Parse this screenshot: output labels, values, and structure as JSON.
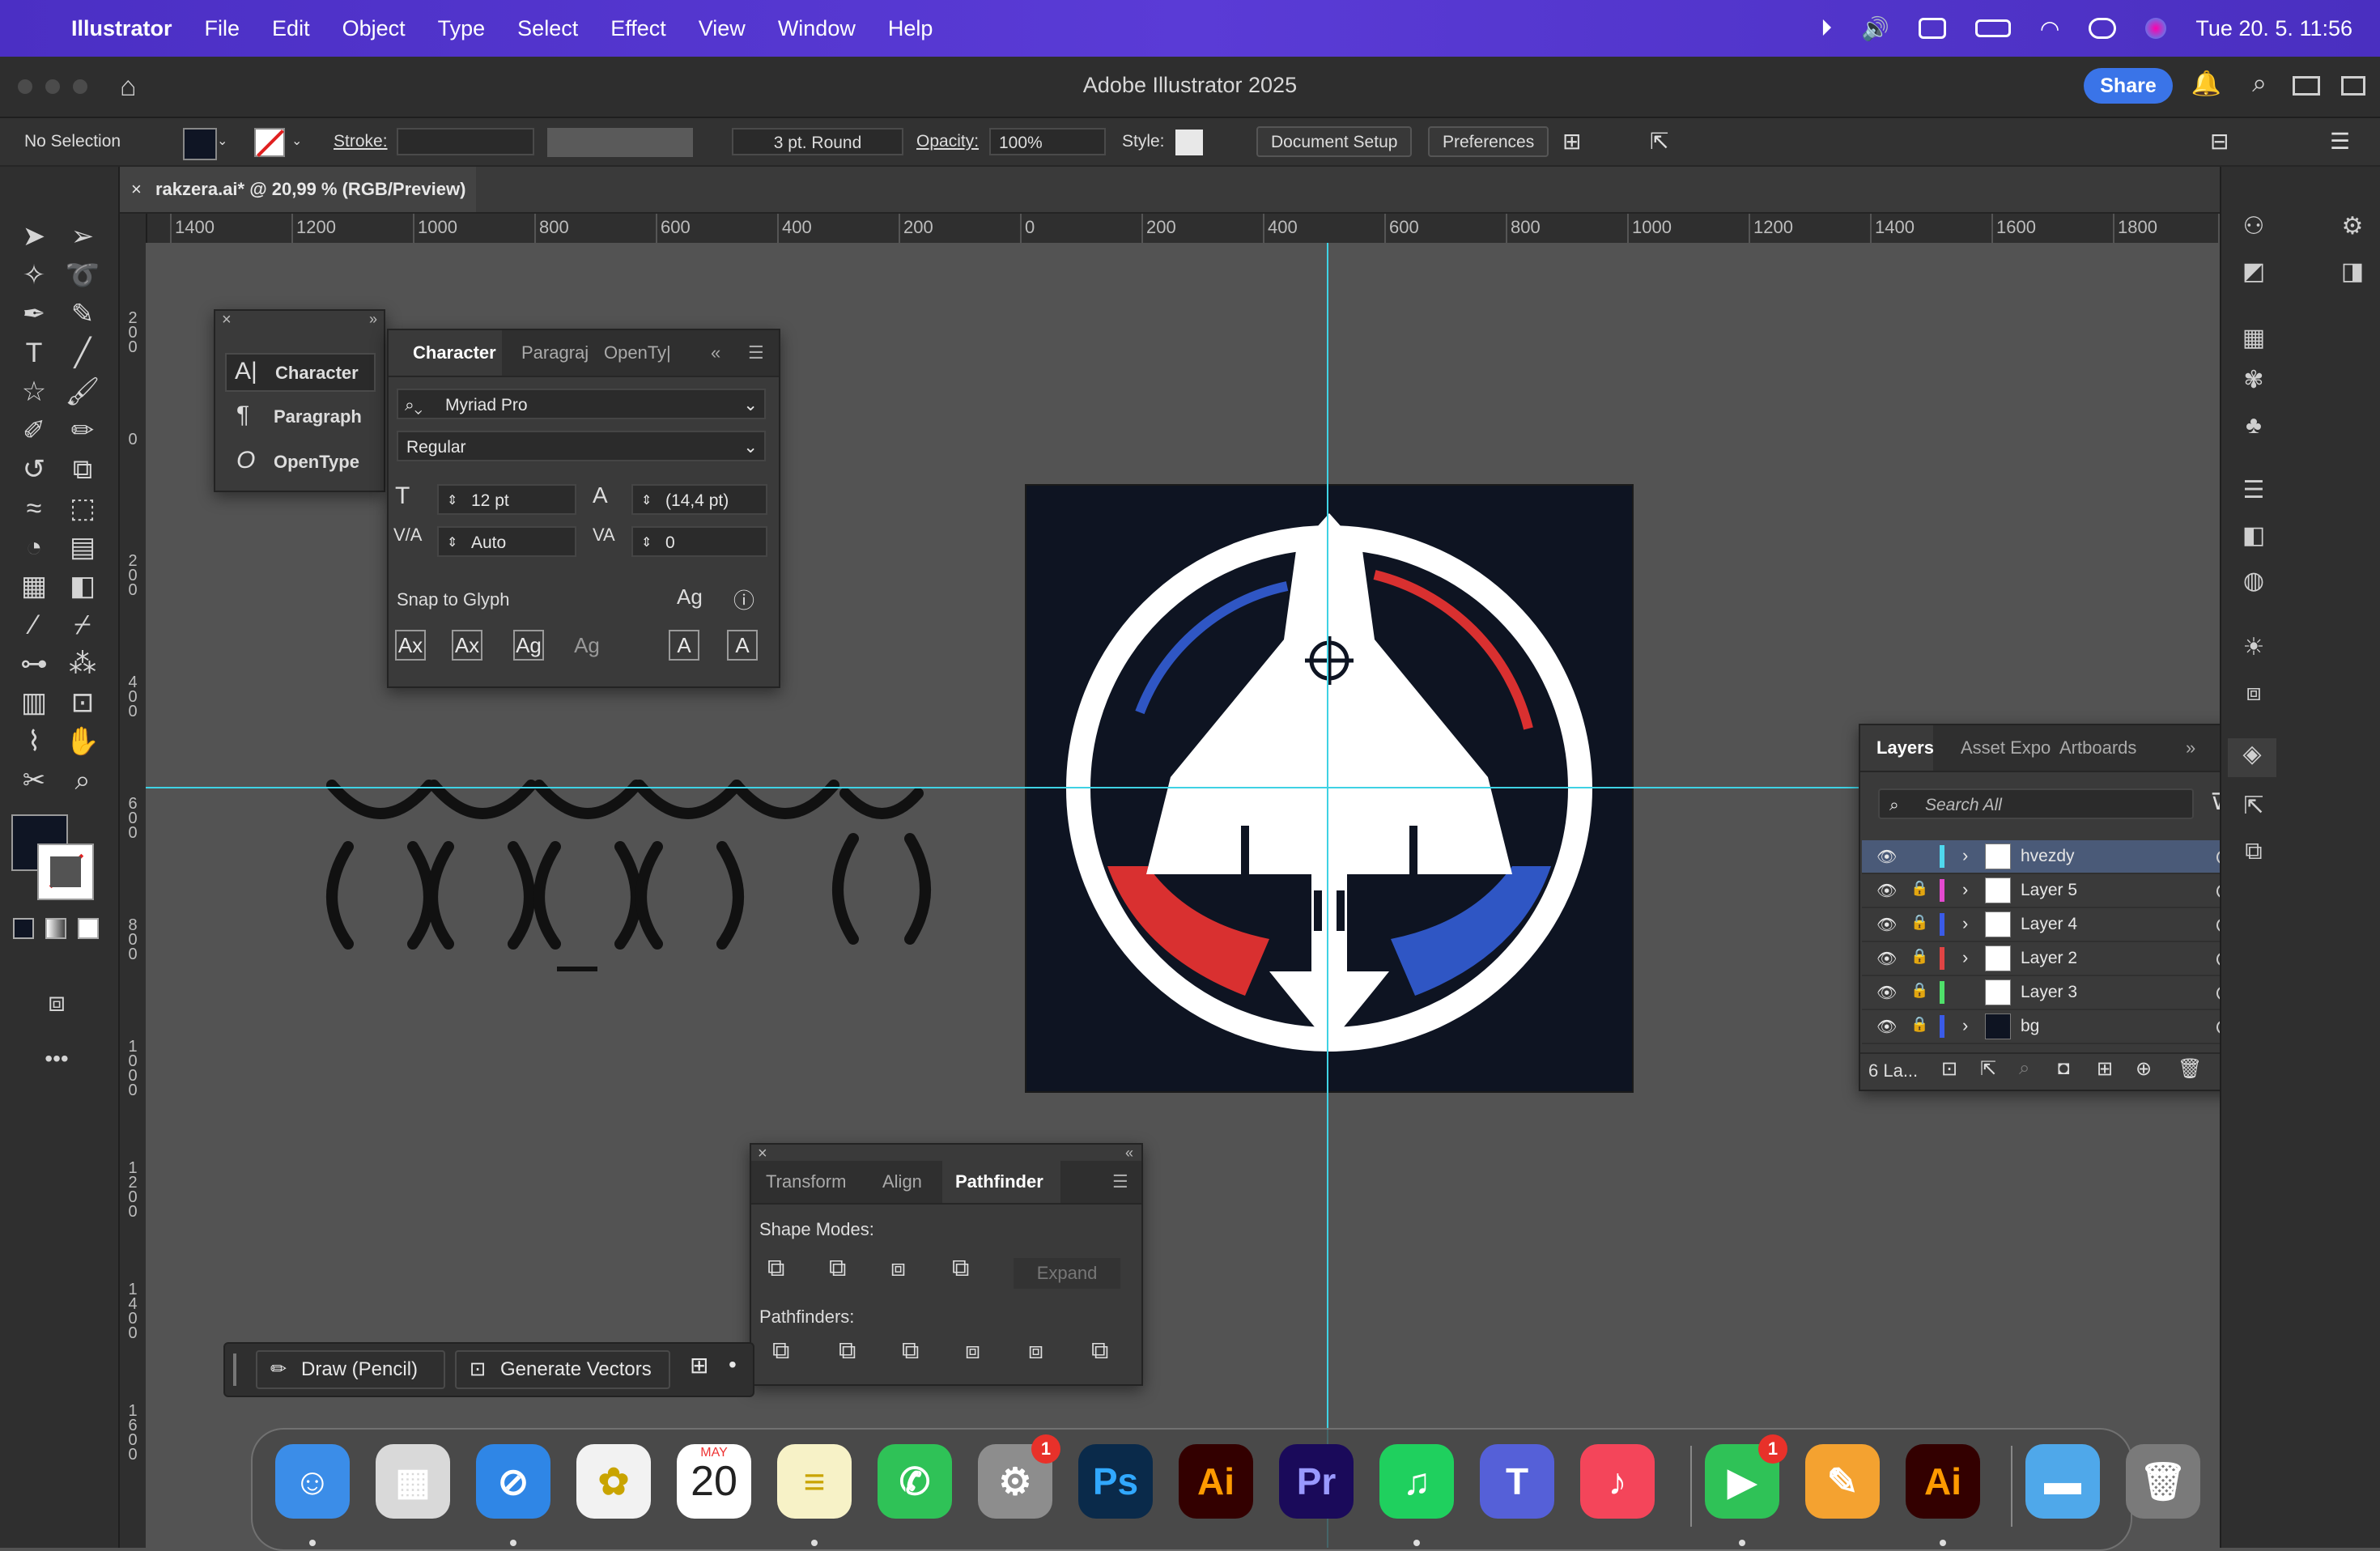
{
  "menubar": {
    "app": "Illustrator",
    "items": [
      "File",
      "Edit",
      "Object",
      "Type",
      "Select",
      "Effect",
      "View",
      "Window",
      "Help"
    ],
    "datetime": "Tue 20. 5.  11:56"
  },
  "titlebar": {
    "title": "Adobe Illustrator 2025",
    "share": "Share"
  },
  "control": {
    "selection": "No Selection",
    "stroke_label": "Stroke:",
    "brush": "3 pt. Round",
    "opacity_label": "Opacity:",
    "opacity": "100%",
    "style_label": "Style:",
    "document_setup": "Document Setup",
    "preferences": "Preferences"
  },
  "document": {
    "tab": "rakzera.ai* @ 20,99 % (RGB/Preview)"
  },
  "ruler": {
    "h": [
      "1400",
      "1200",
      "1000",
      "800",
      "600",
      "400",
      "200",
      "0",
      "200",
      "400",
      "600",
      "800",
      "1000",
      "1200",
      "1400",
      "1600",
      "1800"
    ],
    "v": [
      "200",
      "0",
      "200",
      "400",
      "600",
      "800",
      "1000",
      "1200",
      "1400",
      "1600"
    ]
  },
  "char_menu": {
    "items": [
      "Character",
      "Paragraph",
      "OpenType"
    ]
  },
  "character": {
    "tabs": [
      "Character",
      "Paragraj",
      "OpenTy|"
    ],
    "font": "Myriad Pro",
    "style": "Regular",
    "size": "12 pt",
    "leading": "(14,4 pt)",
    "kerning": "Auto",
    "tracking": "0",
    "snap": "Snap to Glyph",
    "glyph_buttons": [
      "Ax",
      "Ax",
      "Ag",
      "Ag",
      "A",
      "A"
    ]
  },
  "pathfinder": {
    "tabs": [
      "Transform",
      "Align",
      "Pathfinder"
    ],
    "shape_modes": "Shape Modes:",
    "expand": "Expand",
    "pathfinders": "Pathfinders:"
  },
  "layers": {
    "tabs": [
      "Layers",
      "Asset Expo",
      "Artboards"
    ],
    "search": "Search All",
    "rows": [
      {
        "name": "hvezdy",
        "color": "#4fd8ee",
        "selected": true,
        "locked": false,
        "expand": true
      },
      {
        "name": "Layer 5",
        "color": "#e44ad0",
        "selected": false,
        "locked": true,
        "expand": true
      },
      {
        "name": "Layer 4",
        "color": "#3a5be8",
        "selected": false,
        "locked": true,
        "expand": true
      },
      {
        "name": "Layer 2",
        "color": "#e04444",
        "selected": false,
        "locked": true,
        "expand": true
      },
      {
        "name": "Layer 3",
        "color": "#4fe06a",
        "selected": false,
        "locked": true,
        "expand": false
      },
      {
        "name": "bg",
        "color": "#3a5be8",
        "selected": false,
        "locked": true,
        "expand": true
      }
    ],
    "count": "6 La..."
  },
  "taskbar": {
    "draw": "Draw (Pencil)",
    "generate": "Generate Vectors"
  },
  "dock": {
    "apps": [
      {
        "name": "Finder",
        "label": "☺",
        "bg": "#3b8de8"
      },
      {
        "name": "Launchpad",
        "label": "▦",
        "bg": "#d9d9d9"
      },
      {
        "name": "Safari",
        "label": "⊘",
        "bg": "#2f86e6"
      },
      {
        "name": "Photos",
        "label": "✿",
        "bg": "#f2f2f2"
      },
      {
        "name": "Calendar",
        "label": "20",
        "bg": "#ffffff"
      },
      {
        "name": "Notes",
        "label": "≡",
        "bg": "#f7f2c7"
      },
      {
        "name": "WhatsApp",
        "label": "✆",
        "bg": "#2fc257"
      },
      {
        "name": "System Settings",
        "label": "⚙",
        "bg": "#8d8d8d"
      },
      {
        "name": "Photoshop",
        "label": "Ps",
        "bg": "#0a2a4a"
      },
      {
        "name": "Illustrator",
        "label": "Ai",
        "bg": "#330000"
      },
      {
        "name": "Premiere",
        "label": "Pr",
        "bg": "#1a0a5a"
      },
      {
        "name": "Spotify",
        "label": "♫",
        "bg": "#1fd05e"
      },
      {
        "name": "Teams",
        "label": "T",
        "bg": "#5560d8"
      },
      {
        "name": "Music",
        "label": "♪",
        "bg": "#f4455a"
      },
      {
        "name": "FaceTime",
        "label": "▶",
        "bg": "#2fc257"
      },
      {
        "name": "Pages",
        "label": "✎",
        "bg": "#f4a230"
      },
      {
        "name": "Illustrator2",
        "label": "Ai",
        "bg": "#330000"
      },
      {
        "name": "Downloads",
        "label": "▬",
        "bg": "#4fa8ea"
      },
      {
        "name": "Trash",
        "label": "🗑",
        "bg": "#7a7a7a"
      }
    ],
    "calendar_month": "MAY",
    "badges": {
      "settings": "1",
      "facetime": "1"
    }
  }
}
